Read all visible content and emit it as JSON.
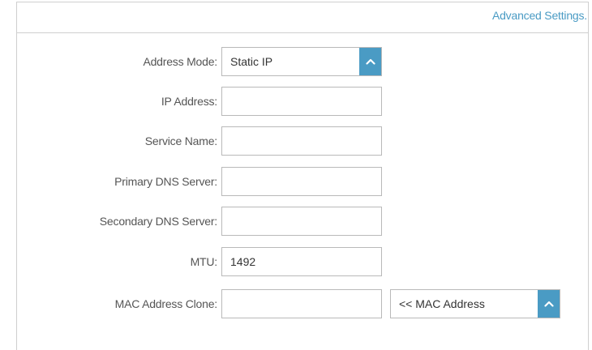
{
  "header": {
    "advanced_link": "Advanced Settings."
  },
  "form": {
    "address_mode": {
      "label": "Address Mode:",
      "value": "Static IP"
    },
    "ip_address": {
      "label": "IP Address:",
      "value": ""
    },
    "service_name": {
      "label": "Service Name:",
      "value": ""
    },
    "primary_dns": {
      "label": "Primary DNS Server:",
      "value": ""
    },
    "secondary_dns": {
      "label": "Secondary DNS Server:",
      "value": ""
    },
    "mtu": {
      "label": "MTU:",
      "value": "1492"
    },
    "mac_clone": {
      "label": "MAC Address Clone:",
      "value": "",
      "select_value": "<< MAC Address"
    }
  },
  "colors": {
    "accent": "#4a9bc4",
    "border": "#b9b9b9",
    "label": "#555555"
  }
}
